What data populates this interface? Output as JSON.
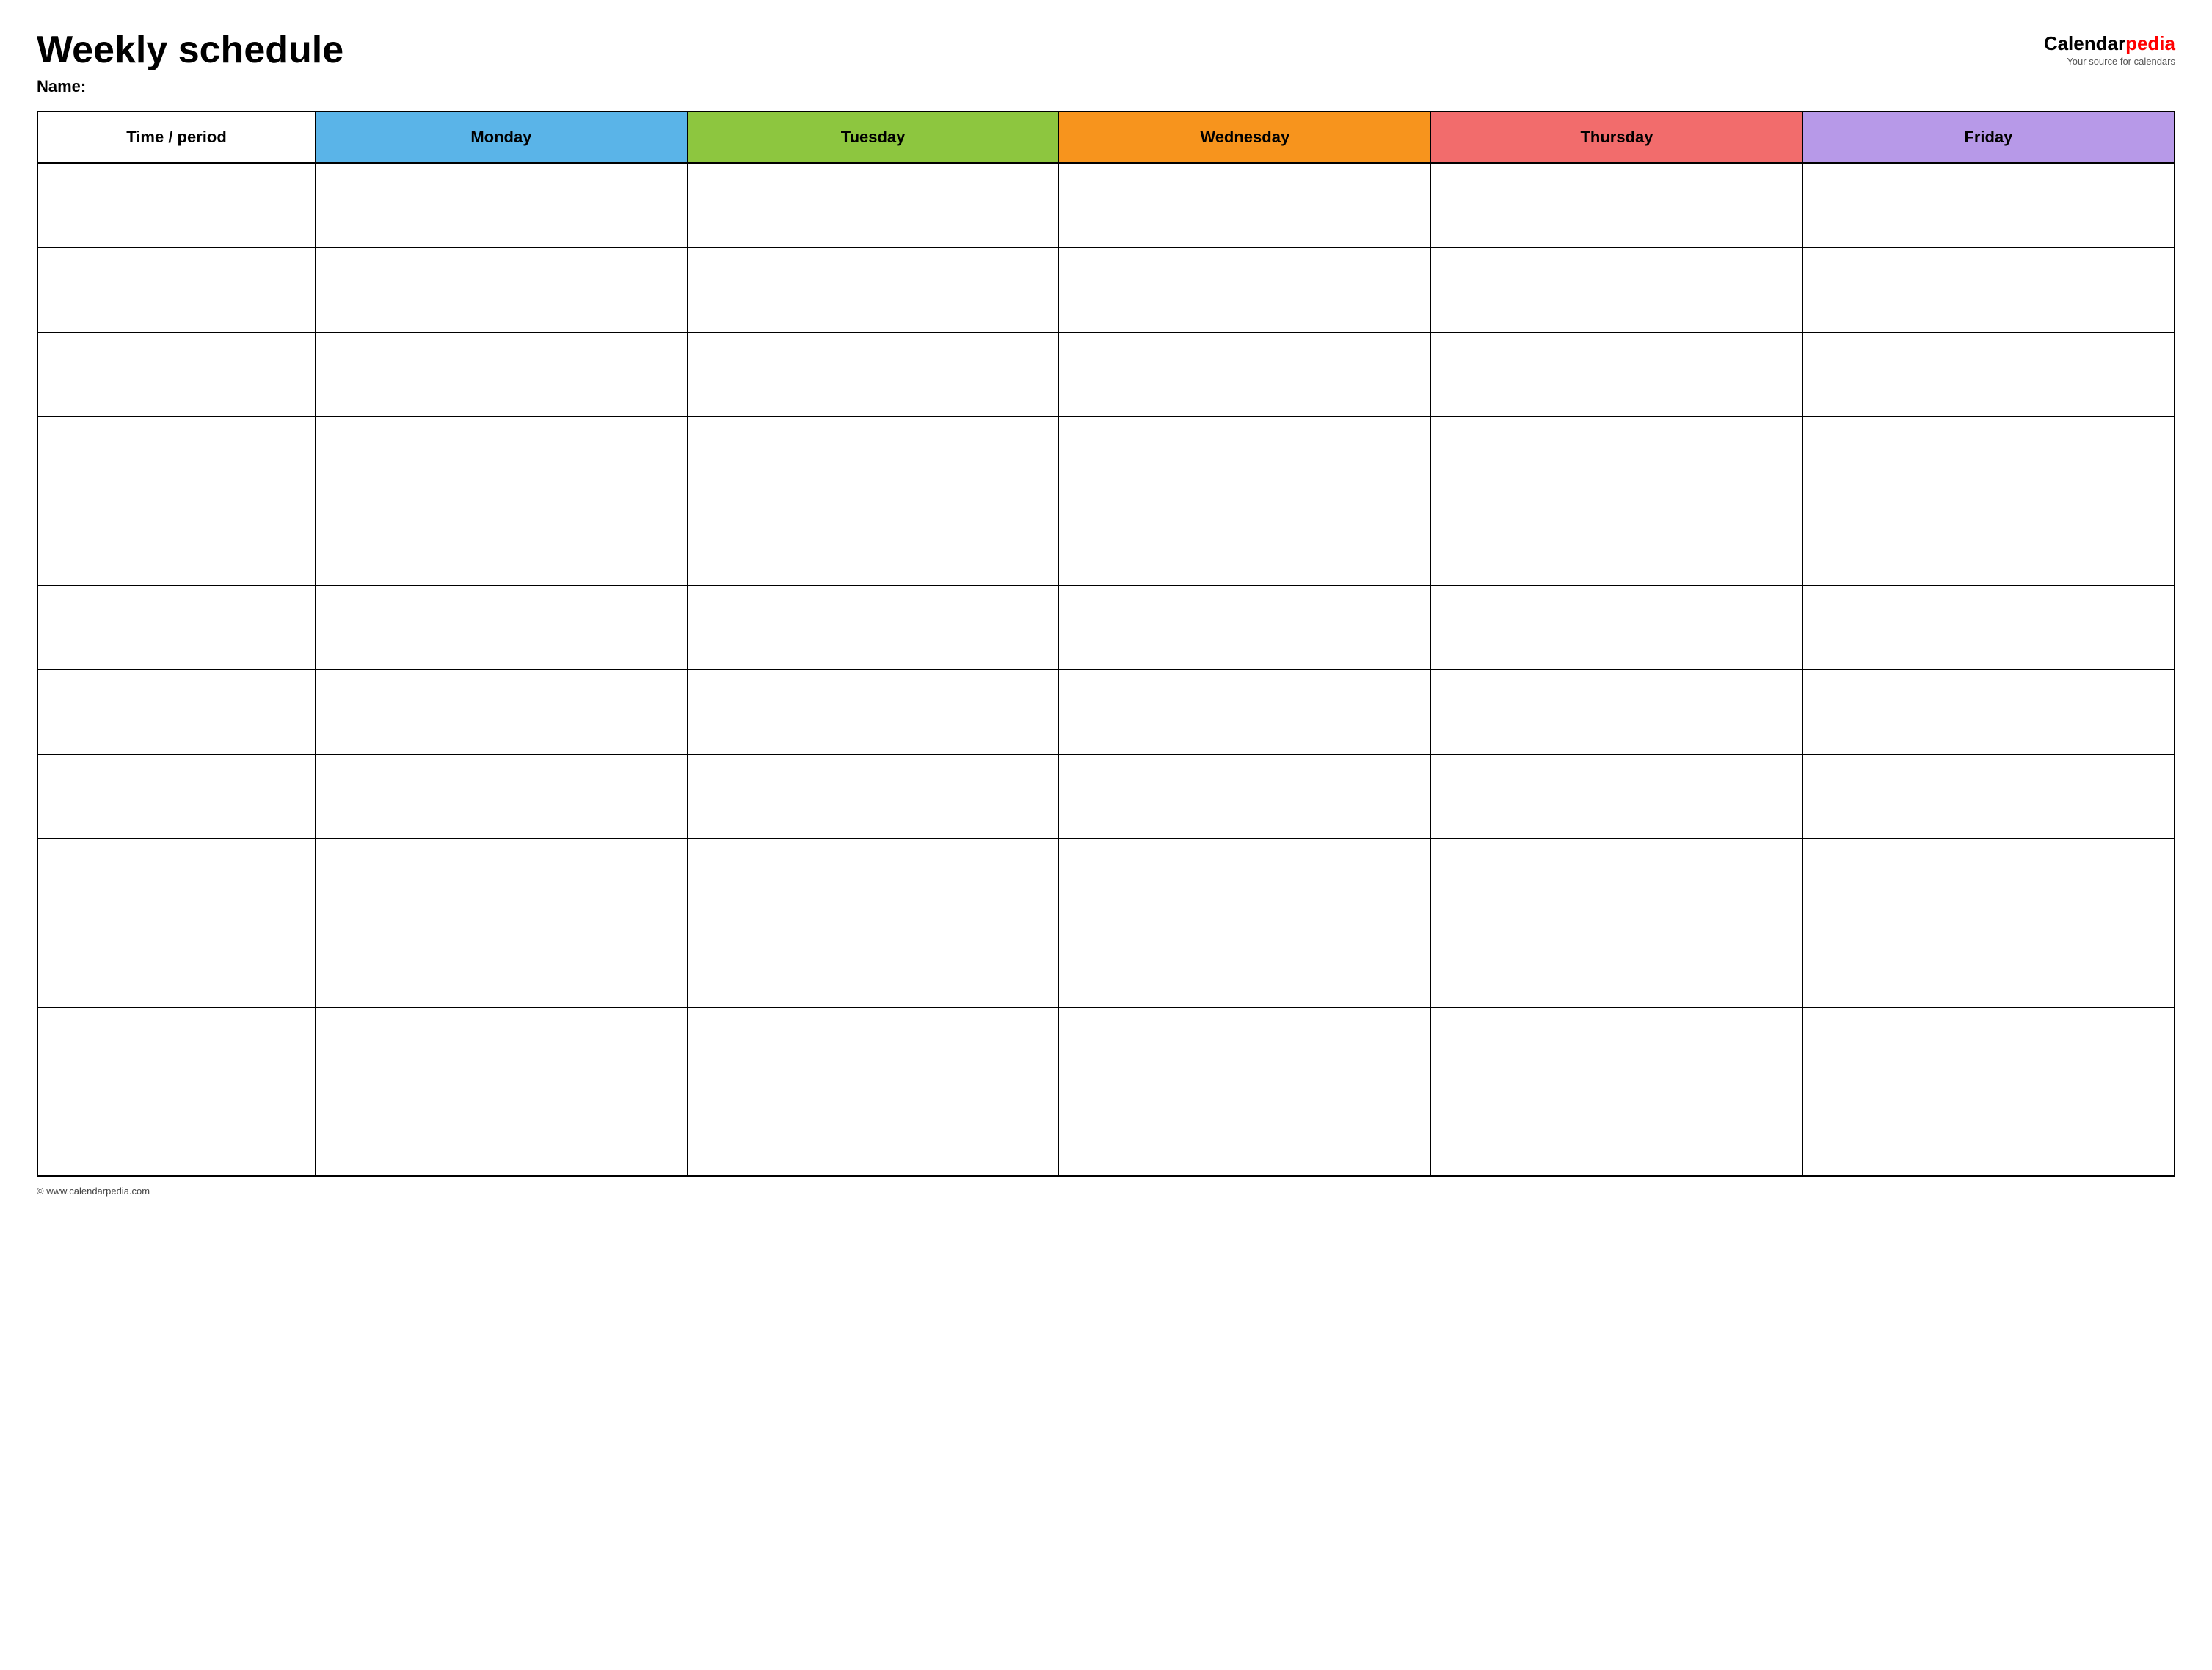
{
  "header": {
    "title": "Weekly schedule",
    "name_label": "Name:",
    "logo": {
      "calendar_part": "Calendar",
      "pedia_part": "pedia",
      "tagline": "Your source for calendars"
    }
  },
  "table": {
    "columns": [
      {
        "id": "time",
        "label": "Time / period",
        "color": "#ffffff",
        "class": "th-time"
      },
      {
        "id": "monday",
        "label": "Monday",
        "color": "#5ab4e8",
        "class": "th-monday"
      },
      {
        "id": "tuesday",
        "label": "Tuesday",
        "color": "#8dc63f",
        "class": "th-tuesday"
      },
      {
        "id": "wednesday",
        "label": "Wednesday",
        "color": "#f7941d",
        "class": "th-wednesday"
      },
      {
        "id": "thursday",
        "label": "Thursday",
        "color": "#f26c6c",
        "class": "th-thursday"
      },
      {
        "id": "friday",
        "label": "Friday",
        "color": "#b799e8",
        "class": "th-friday"
      }
    ],
    "rows": 12
  },
  "footer": {
    "copyright": "© www.calendarpedia.com"
  }
}
